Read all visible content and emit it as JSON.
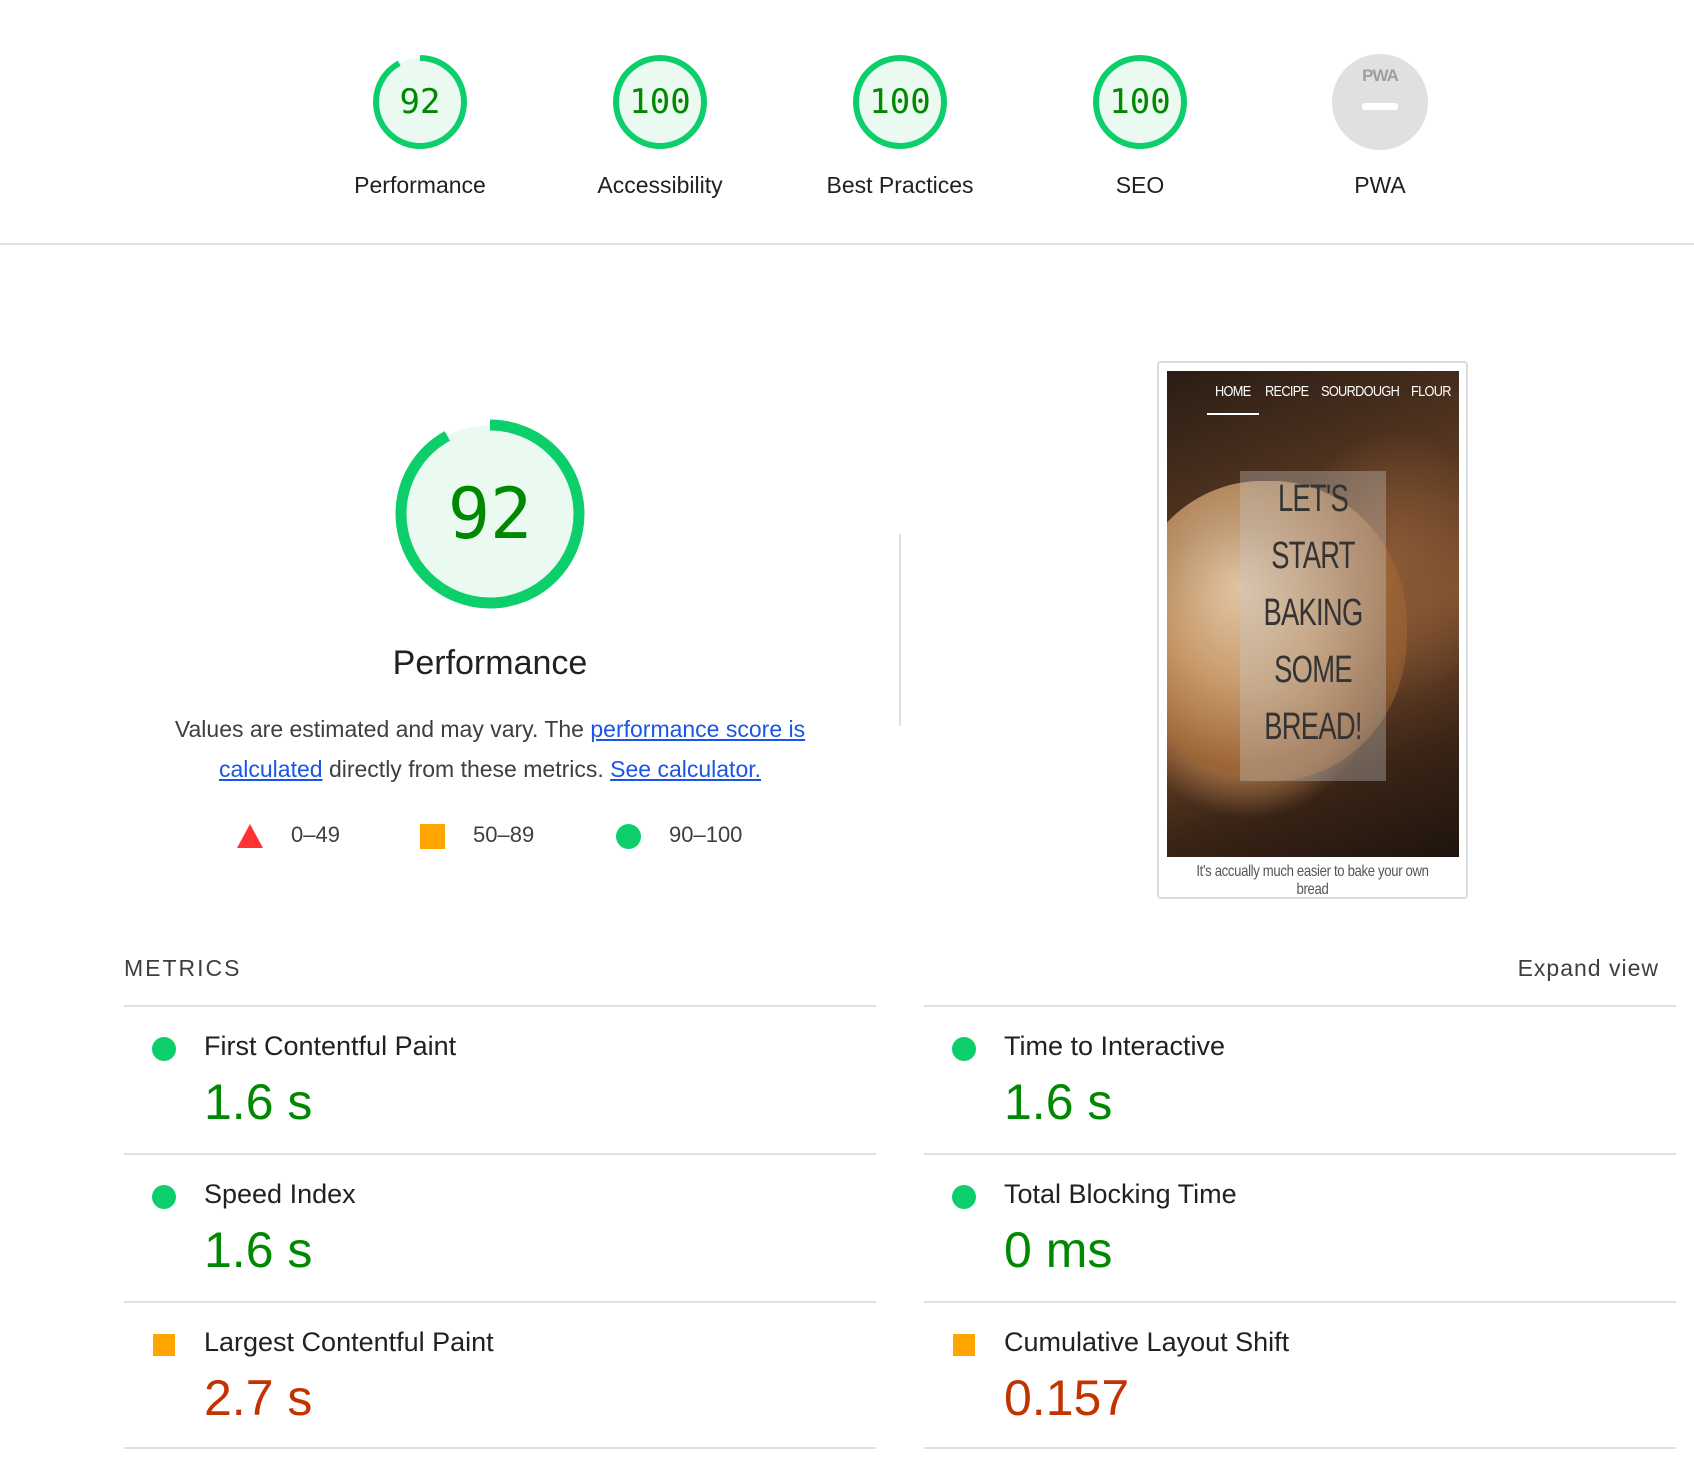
{
  "categories": [
    {
      "id": "performance",
      "score": "92",
      "label": "Performance",
      "progress": 0.92,
      "status": "pass"
    },
    {
      "id": "accessibility",
      "score": "100",
      "label": "Accessibility",
      "progress": 1.0,
      "status": "pass"
    },
    {
      "id": "best-practices",
      "score": "100",
      "label": "Best Practices",
      "progress": 1.0,
      "status": "pass"
    },
    {
      "id": "seo",
      "score": "100",
      "label": "SEO",
      "progress": 1.0,
      "status": "pass"
    },
    {
      "id": "pwa",
      "score": "",
      "label": "PWA",
      "badge": "PWA",
      "status": "na"
    }
  ],
  "performance": {
    "score": "92",
    "progress": 0.92,
    "title": "Performance",
    "desc_prefix": "Values are estimated and may vary. The ",
    "desc_link1": "performance score is calculated",
    "desc_middle": " directly from these metrics. ",
    "desc_link2": "See calculator."
  },
  "legend": {
    "fail": "0–49",
    "average": "50–89",
    "pass": "90–100"
  },
  "screenshot": {
    "nav": [
      "HOME",
      "RECIPE",
      "SOURDOUGH",
      "FLOUR"
    ],
    "hero_lines": [
      "LET'S",
      "START",
      "BAKING",
      "SOME",
      "BREAD!"
    ],
    "caption": "It's accually much easier to bake your own bread"
  },
  "metrics": {
    "header": "METRICS",
    "expand": "Expand view",
    "items": [
      {
        "name": "First Contentful Paint",
        "value": "1.6 s",
        "status": "pass"
      },
      {
        "name": "Time to Interactive",
        "value": "1.6 s",
        "status": "pass"
      },
      {
        "name": "Speed Index",
        "value": "1.6 s",
        "status": "pass"
      },
      {
        "name": "Total Blocking Time",
        "value": "0 ms",
        "status": "pass"
      },
      {
        "name": "Largest Contentful Paint",
        "value": "2.7 s",
        "status": "avg"
      },
      {
        "name": "Cumulative Layout Shift",
        "value": "0.157",
        "status": "avg"
      }
    ]
  },
  "colors": {
    "pass": "#0cce6b",
    "pass_text": "#008800",
    "pass_fill": "#eafaf1",
    "average": "#ffa400",
    "average_text": "#c33300",
    "fail": "#ff3333",
    "na": "#e0e0e0",
    "link": "#1a55e8"
  }
}
